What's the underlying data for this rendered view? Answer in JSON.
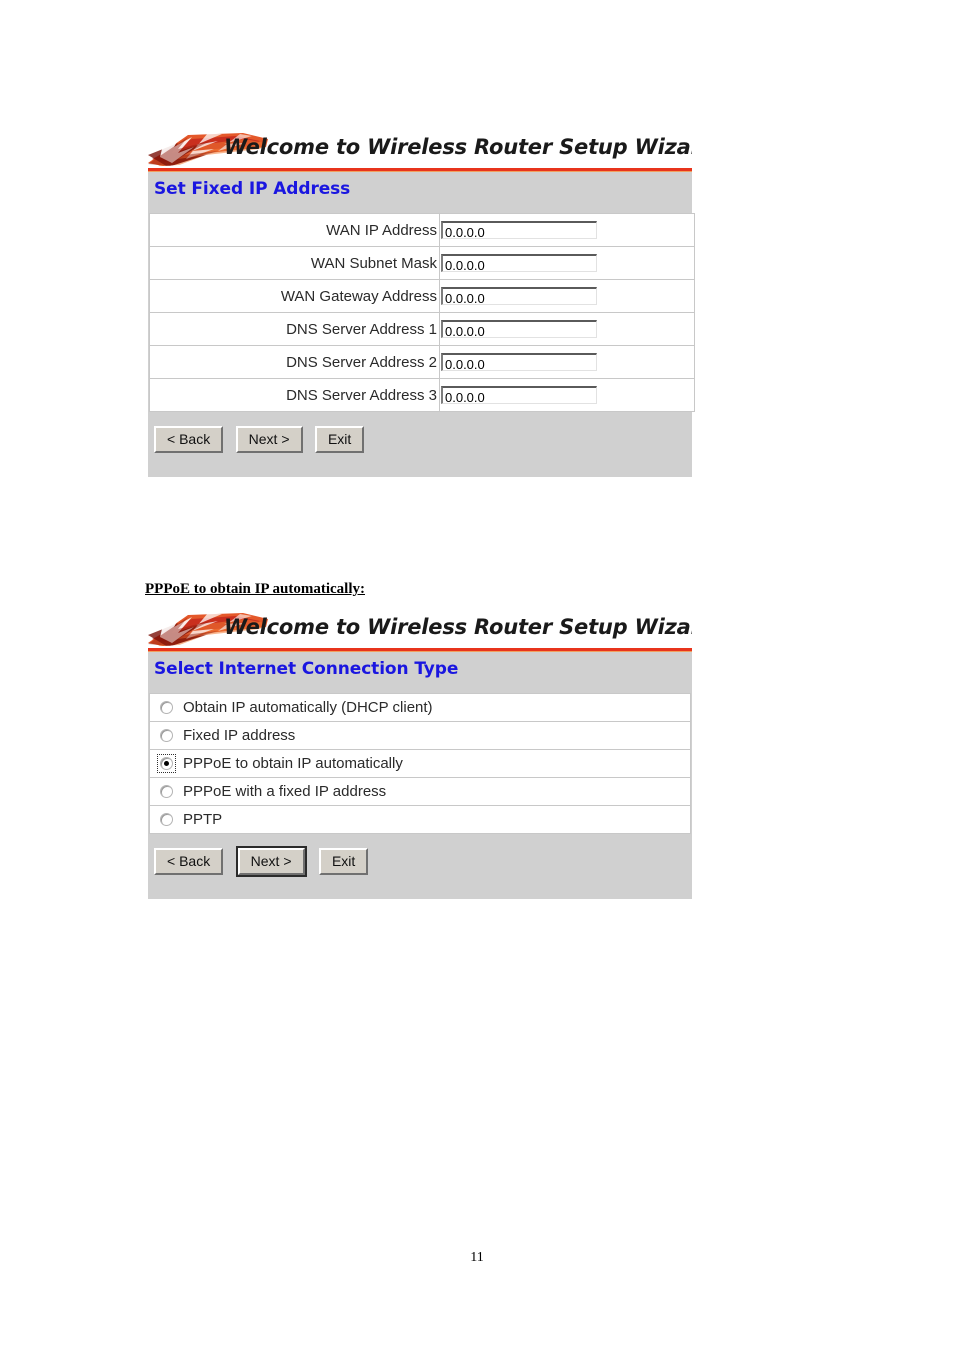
{
  "document": {
    "page_number": "11",
    "caption": "PPPoE to obtain IP automatically:"
  },
  "colors": {
    "heading_blue": "#1a16e0",
    "banner_rule_red": "#e8341c",
    "panel_gray": "#d0d0d0",
    "button_face": "#d4d0c8"
  },
  "panel_fixed_ip": {
    "banner_title": "Welcome to Wireless Router Setup Wizard",
    "heading": "Set Fixed IP Address",
    "fields": [
      {
        "label": "WAN IP Address",
        "value": "0.0.0.0"
      },
      {
        "label": "WAN Subnet Mask",
        "value": "0.0.0.0"
      },
      {
        "label": "WAN Gateway Address",
        "value": "0.0.0.0"
      },
      {
        "label": "DNS Server Address 1",
        "value": "0.0.0.0"
      },
      {
        "label": "DNS Server Address 2",
        "value": "0.0.0.0"
      },
      {
        "label": "DNS Server Address 3",
        "value": "0.0.0.0"
      }
    ],
    "buttons": {
      "back": "< Back",
      "next": "Next >",
      "exit": "Exit"
    }
  },
  "panel_connection_type": {
    "banner_title": "Welcome to Wireless Router Setup Wizard",
    "heading": "Select Internet Connection Type",
    "options": [
      {
        "label": "Obtain IP automatically (DHCP client)",
        "selected": false
      },
      {
        "label": "Fixed IP address",
        "selected": false
      },
      {
        "label": "PPPoE to obtain IP automatically",
        "selected": true
      },
      {
        "label": "PPPoE with a fixed IP address",
        "selected": false
      },
      {
        "label": "PPTP",
        "selected": false
      }
    ],
    "buttons": {
      "back": "< Back",
      "next": "Next >",
      "exit": "Exit"
    }
  }
}
